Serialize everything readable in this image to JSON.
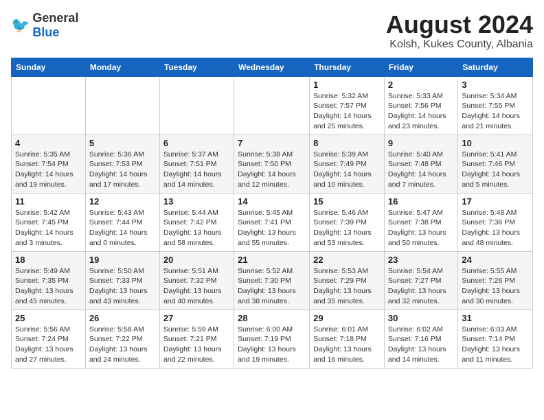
{
  "header": {
    "logo_general": "General",
    "logo_blue": "Blue",
    "month_year": "August 2024",
    "location": "Kolsh, Kukes County, Albania"
  },
  "weekdays": [
    "Sunday",
    "Monday",
    "Tuesday",
    "Wednesday",
    "Thursday",
    "Friday",
    "Saturday"
  ],
  "weeks": [
    [
      {
        "day": "",
        "info": ""
      },
      {
        "day": "",
        "info": ""
      },
      {
        "day": "",
        "info": ""
      },
      {
        "day": "",
        "info": ""
      },
      {
        "day": "1",
        "info": "Sunrise: 5:32 AM\nSunset: 7:57 PM\nDaylight: 14 hours\nand 25 minutes."
      },
      {
        "day": "2",
        "info": "Sunrise: 5:33 AM\nSunset: 7:56 PM\nDaylight: 14 hours\nand 23 minutes."
      },
      {
        "day": "3",
        "info": "Sunrise: 5:34 AM\nSunset: 7:55 PM\nDaylight: 14 hours\nand 21 minutes."
      }
    ],
    [
      {
        "day": "4",
        "info": "Sunrise: 5:35 AM\nSunset: 7:54 PM\nDaylight: 14 hours\nand 19 minutes."
      },
      {
        "day": "5",
        "info": "Sunrise: 5:36 AM\nSunset: 7:53 PM\nDaylight: 14 hours\nand 17 minutes."
      },
      {
        "day": "6",
        "info": "Sunrise: 5:37 AM\nSunset: 7:51 PM\nDaylight: 14 hours\nand 14 minutes."
      },
      {
        "day": "7",
        "info": "Sunrise: 5:38 AM\nSunset: 7:50 PM\nDaylight: 14 hours\nand 12 minutes."
      },
      {
        "day": "8",
        "info": "Sunrise: 5:39 AM\nSunset: 7:49 PM\nDaylight: 14 hours\nand 10 minutes."
      },
      {
        "day": "9",
        "info": "Sunrise: 5:40 AM\nSunset: 7:48 PM\nDaylight: 14 hours\nand 7 minutes."
      },
      {
        "day": "10",
        "info": "Sunrise: 5:41 AM\nSunset: 7:46 PM\nDaylight: 14 hours\nand 5 minutes."
      }
    ],
    [
      {
        "day": "11",
        "info": "Sunrise: 5:42 AM\nSunset: 7:45 PM\nDaylight: 14 hours\nand 3 minutes."
      },
      {
        "day": "12",
        "info": "Sunrise: 5:43 AM\nSunset: 7:44 PM\nDaylight: 14 hours\nand 0 minutes."
      },
      {
        "day": "13",
        "info": "Sunrise: 5:44 AM\nSunset: 7:42 PM\nDaylight: 13 hours\nand 58 minutes."
      },
      {
        "day": "14",
        "info": "Sunrise: 5:45 AM\nSunset: 7:41 PM\nDaylight: 13 hours\nand 55 minutes."
      },
      {
        "day": "15",
        "info": "Sunrise: 5:46 AM\nSunset: 7:39 PM\nDaylight: 13 hours\nand 53 minutes."
      },
      {
        "day": "16",
        "info": "Sunrise: 5:47 AM\nSunset: 7:38 PM\nDaylight: 13 hours\nand 50 minutes."
      },
      {
        "day": "17",
        "info": "Sunrise: 5:48 AM\nSunset: 7:36 PM\nDaylight: 13 hours\nand 48 minutes."
      }
    ],
    [
      {
        "day": "18",
        "info": "Sunrise: 5:49 AM\nSunset: 7:35 PM\nDaylight: 13 hours\nand 45 minutes."
      },
      {
        "day": "19",
        "info": "Sunrise: 5:50 AM\nSunset: 7:33 PM\nDaylight: 13 hours\nand 43 minutes."
      },
      {
        "day": "20",
        "info": "Sunrise: 5:51 AM\nSunset: 7:32 PM\nDaylight: 13 hours\nand 40 minutes."
      },
      {
        "day": "21",
        "info": "Sunrise: 5:52 AM\nSunset: 7:30 PM\nDaylight: 13 hours\nand 38 minutes."
      },
      {
        "day": "22",
        "info": "Sunrise: 5:53 AM\nSunset: 7:29 PM\nDaylight: 13 hours\nand 35 minutes."
      },
      {
        "day": "23",
        "info": "Sunrise: 5:54 AM\nSunset: 7:27 PM\nDaylight: 13 hours\nand 32 minutes."
      },
      {
        "day": "24",
        "info": "Sunrise: 5:55 AM\nSunset: 7:26 PM\nDaylight: 13 hours\nand 30 minutes."
      }
    ],
    [
      {
        "day": "25",
        "info": "Sunrise: 5:56 AM\nSunset: 7:24 PM\nDaylight: 13 hours\nand 27 minutes."
      },
      {
        "day": "26",
        "info": "Sunrise: 5:58 AM\nSunset: 7:22 PM\nDaylight: 13 hours\nand 24 minutes."
      },
      {
        "day": "27",
        "info": "Sunrise: 5:59 AM\nSunset: 7:21 PM\nDaylight: 13 hours\nand 22 minutes."
      },
      {
        "day": "28",
        "info": "Sunrise: 6:00 AM\nSunset: 7:19 PM\nDaylight: 13 hours\nand 19 minutes."
      },
      {
        "day": "29",
        "info": "Sunrise: 6:01 AM\nSunset: 7:18 PM\nDaylight: 13 hours\nand 16 minutes."
      },
      {
        "day": "30",
        "info": "Sunrise: 6:02 AM\nSunset: 7:16 PM\nDaylight: 13 hours\nand 14 minutes."
      },
      {
        "day": "31",
        "info": "Sunrise: 6:03 AM\nSunset: 7:14 PM\nDaylight: 13 hours\nand 11 minutes."
      }
    ]
  ]
}
